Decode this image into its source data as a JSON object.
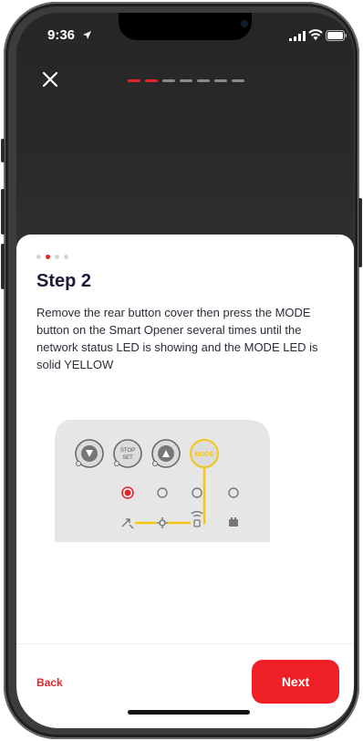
{
  "status_bar": {
    "time": "9:36"
  },
  "onboarding": {
    "progress_total": 7,
    "progress_completed": 2,
    "page_dots_total": 4,
    "page_dot_active": 2
  },
  "step": {
    "title": "Step 2",
    "description": "Remove the rear button cover then press the MODE button on the Smart Opener several times until the network status LED is showing and the MODE LED is solid YELLOW"
  },
  "diagram": {
    "stop_set_top": "STOP",
    "stop_set_bottom": "SET",
    "mode_label": "MODE"
  },
  "footer": {
    "back_label": "Back",
    "next_label": "Next"
  },
  "colors": {
    "accent_red": "#e3242b",
    "mode_yellow": "#f5c518",
    "panel_gray": "#e8e8e8"
  }
}
